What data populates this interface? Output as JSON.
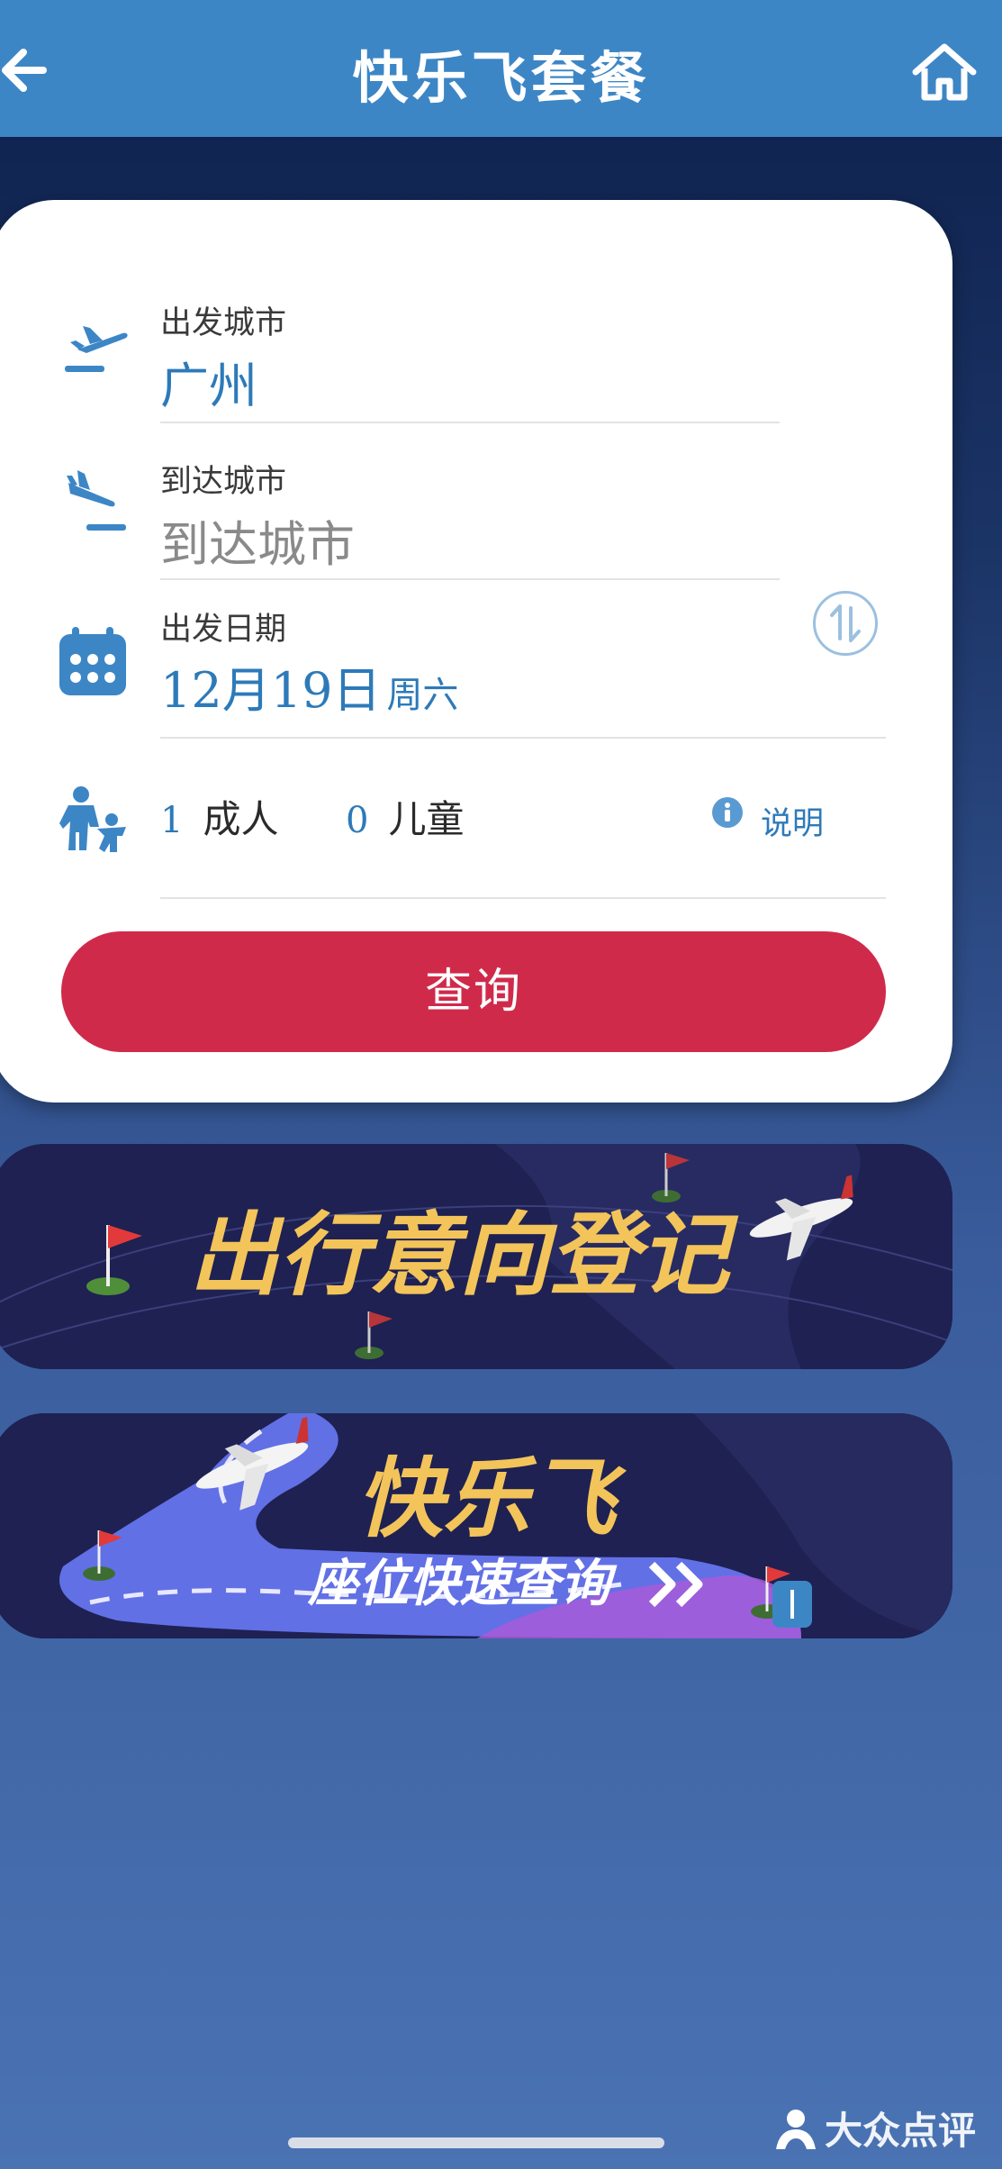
{
  "header": {
    "title": "快乐飞套餐"
  },
  "form": {
    "departure": {
      "label": "出发城市",
      "value": "广州"
    },
    "arrival": {
      "label": "到达城市",
      "placeholder": "到达城市"
    },
    "date": {
      "label": "出发日期",
      "value": "12月19日",
      "weekday": "周六"
    },
    "passengers": {
      "adult_count": "1",
      "adult_label": "成人",
      "child_count": "0",
      "child_label": "儿童"
    },
    "explain_label": "说明",
    "query_label": "查询"
  },
  "banners": {
    "banner1_text": "出行意向登记",
    "banner2_title": "快乐飞",
    "banner2_subtitle": "座位快速查询"
  },
  "watermark": "大众点评",
  "colors": {
    "nav_bg": "#3d86c6",
    "accent_blue": "#2d7ab9",
    "query_button": "#d02a4b",
    "banner_text": "#f3c45a"
  }
}
